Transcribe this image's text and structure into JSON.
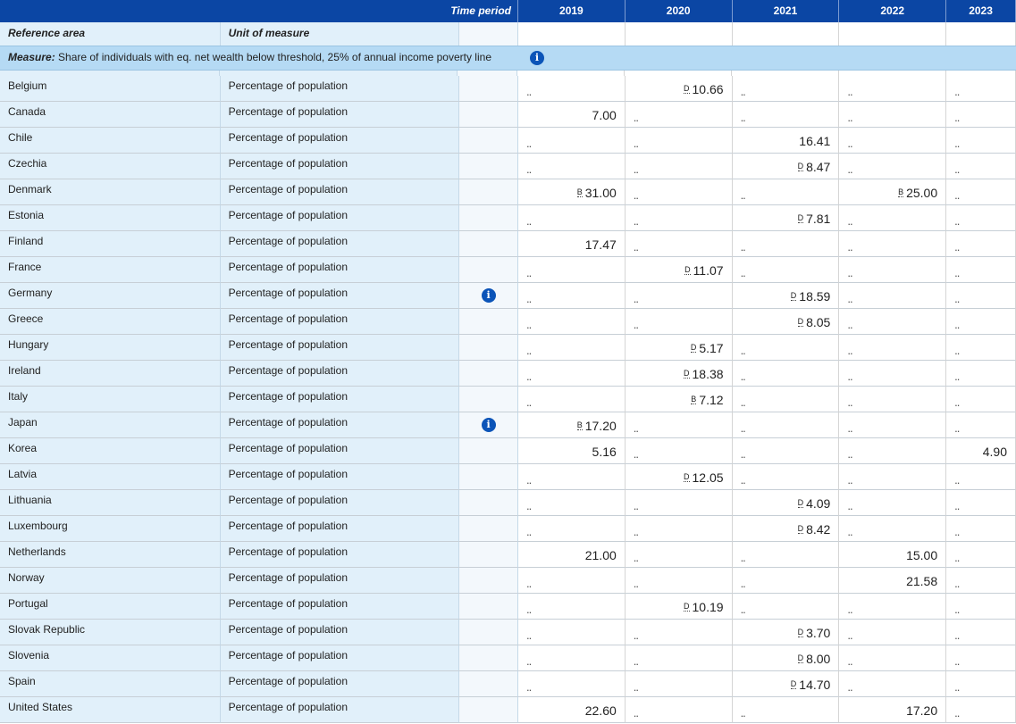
{
  "header": {
    "time_period_label": "Time period",
    "years": [
      "2019",
      "2020",
      "2021",
      "2022",
      "2023"
    ]
  },
  "columns": {
    "reference_area": "Reference area",
    "unit_of_measure": "Unit of measure"
  },
  "measure": {
    "prefix": "Measure:",
    "text": "Share of individuals with eq. net wealth below threshold, 25% of annual income poverty line"
  },
  "missing_symbol": "..",
  "rows": [
    {
      "area": "Belgium",
      "unit": "Percentage of population",
      "info": false,
      "cells": [
        {
          "v": "",
          "f": ""
        },
        {
          "v": "10.66",
          "f": "D"
        },
        {
          "v": "",
          "f": ""
        },
        {
          "v": "",
          "f": ""
        },
        {
          "v": "",
          "f": ""
        }
      ]
    },
    {
      "area": "Canada",
      "unit": "Percentage of population",
      "info": false,
      "cells": [
        {
          "v": "7.00",
          "f": ""
        },
        {
          "v": "",
          "f": ""
        },
        {
          "v": "",
          "f": ""
        },
        {
          "v": "",
          "f": ""
        },
        {
          "v": "",
          "f": ""
        }
      ]
    },
    {
      "area": "Chile",
      "unit": "Percentage of population",
      "info": false,
      "cells": [
        {
          "v": "",
          "f": ""
        },
        {
          "v": "",
          "f": ""
        },
        {
          "v": "16.41",
          "f": ""
        },
        {
          "v": "",
          "f": ""
        },
        {
          "v": "",
          "f": ""
        }
      ]
    },
    {
      "area": "Czechia",
      "unit": "Percentage of population",
      "info": false,
      "cells": [
        {
          "v": "",
          "f": ""
        },
        {
          "v": "",
          "f": ""
        },
        {
          "v": "8.47",
          "f": "D"
        },
        {
          "v": "",
          "f": ""
        },
        {
          "v": "",
          "f": ""
        }
      ]
    },
    {
      "area": "Denmark",
      "unit": "Percentage of population",
      "info": false,
      "cells": [
        {
          "v": "31.00",
          "f": "B"
        },
        {
          "v": "",
          "f": ""
        },
        {
          "v": "",
          "f": ""
        },
        {
          "v": "25.00",
          "f": "B"
        },
        {
          "v": "",
          "f": ""
        }
      ]
    },
    {
      "area": "Estonia",
      "unit": "Percentage of population",
      "info": false,
      "cells": [
        {
          "v": "",
          "f": ""
        },
        {
          "v": "",
          "f": ""
        },
        {
          "v": "7.81",
          "f": "D"
        },
        {
          "v": "",
          "f": ""
        },
        {
          "v": "",
          "f": ""
        }
      ]
    },
    {
      "area": "Finland",
      "unit": "Percentage of population",
      "info": false,
      "cells": [
        {
          "v": "17.47",
          "f": ""
        },
        {
          "v": "",
          "f": ""
        },
        {
          "v": "",
          "f": ""
        },
        {
          "v": "",
          "f": ""
        },
        {
          "v": "",
          "f": ""
        }
      ]
    },
    {
      "area": "France",
      "unit": "Percentage of population",
      "info": false,
      "cells": [
        {
          "v": "",
          "f": ""
        },
        {
          "v": "11.07",
          "f": "D"
        },
        {
          "v": "",
          "f": ""
        },
        {
          "v": "",
          "f": ""
        },
        {
          "v": "",
          "f": ""
        }
      ]
    },
    {
      "area": "Germany",
      "unit": "Percentage of population",
      "info": true,
      "cells": [
        {
          "v": "",
          "f": ""
        },
        {
          "v": "",
          "f": ""
        },
        {
          "v": "18.59",
          "f": "D"
        },
        {
          "v": "",
          "f": ""
        },
        {
          "v": "",
          "f": ""
        }
      ]
    },
    {
      "area": "Greece",
      "unit": "Percentage of population",
      "info": false,
      "cells": [
        {
          "v": "",
          "f": ""
        },
        {
          "v": "",
          "f": ""
        },
        {
          "v": "8.05",
          "f": "D"
        },
        {
          "v": "",
          "f": ""
        },
        {
          "v": "",
          "f": ""
        }
      ]
    },
    {
      "area": "Hungary",
      "unit": "Percentage of population",
      "info": false,
      "cells": [
        {
          "v": "",
          "f": ""
        },
        {
          "v": "5.17",
          "f": "D"
        },
        {
          "v": "",
          "f": ""
        },
        {
          "v": "",
          "f": ""
        },
        {
          "v": "",
          "f": ""
        }
      ]
    },
    {
      "area": "Ireland",
      "unit": "Percentage of population",
      "info": false,
      "cells": [
        {
          "v": "",
          "f": ""
        },
        {
          "v": "18.38",
          "f": "D"
        },
        {
          "v": "",
          "f": ""
        },
        {
          "v": "",
          "f": ""
        },
        {
          "v": "",
          "f": ""
        }
      ]
    },
    {
      "area": "Italy",
      "unit": "Percentage of population",
      "info": false,
      "cells": [
        {
          "v": "",
          "f": ""
        },
        {
          "v": "7.12",
          "f": "B"
        },
        {
          "v": "",
          "f": ""
        },
        {
          "v": "",
          "f": ""
        },
        {
          "v": "",
          "f": ""
        }
      ]
    },
    {
      "area": "Japan",
      "unit": "Percentage of population",
      "info": true,
      "cells": [
        {
          "v": "17.20",
          "f": "B"
        },
        {
          "v": "",
          "f": ""
        },
        {
          "v": "",
          "f": ""
        },
        {
          "v": "",
          "f": ""
        },
        {
          "v": "",
          "f": ""
        }
      ]
    },
    {
      "area": "Korea",
      "unit": "Percentage of population",
      "info": false,
      "cells": [
        {
          "v": "5.16",
          "f": ""
        },
        {
          "v": "",
          "f": ""
        },
        {
          "v": "",
          "f": ""
        },
        {
          "v": "",
          "f": ""
        },
        {
          "v": "4.90",
          "f": ""
        }
      ]
    },
    {
      "area": "Latvia",
      "unit": "Percentage of population",
      "info": false,
      "cells": [
        {
          "v": "",
          "f": ""
        },
        {
          "v": "12.05",
          "f": "D"
        },
        {
          "v": "",
          "f": ""
        },
        {
          "v": "",
          "f": ""
        },
        {
          "v": "",
          "f": ""
        }
      ]
    },
    {
      "area": "Lithuania",
      "unit": "Percentage of population",
      "info": false,
      "cells": [
        {
          "v": "",
          "f": ""
        },
        {
          "v": "",
          "f": ""
        },
        {
          "v": "4.09",
          "f": "D"
        },
        {
          "v": "",
          "f": ""
        },
        {
          "v": "",
          "f": ""
        }
      ]
    },
    {
      "area": "Luxembourg",
      "unit": "Percentage of population",
      "info": false,
      "cells": [
        {
          "v": "",
          "f": ""
        },
        {
          "v": "",
          "f": ""
        },
        {
          "v": "8.42",
          "f": "D"
        },
        {
          "v": "",
          "f": ""
        },
        {
          "v": "",
          "f": ""
        }
      ]
    },
    {
      "area": "Netherlands",
      "unit": "Percentage of population",
      "info": false,
      "cells": [
        {
          "v": "21.00",
          "f": ""
        },
        {
          "v": "",
          "f": ""
        },
        {
          "v": "",
          "f": ""
        },
        {
          "v": "15.00",
          "f": ""
        },
        {
          "v": "",
          "f": ""
        }
      ]
    },
    {
      "area": "Norway",
      "unit": "Percentage of population",
      "info": false,
      "cells": [
        {
          "v": "",
          "f": ""
        },
        {
          "v": "",
          "f": ""
        },
        {
          "v": "",
          "f": ""
        },
        {
          "v": "21.58",
          "f": ""
        },
        {
          "v": "",
          "f": ""
        }
      ]
    },
    {
      "area": "Portugal",
      "unit": "Percentage of population",
      "info": false,
      "cells": [
        {
          "v": "",
          "f": ""
        },
        {
          "v": "10.19",
          "f": "D"
        },
        {
          "v": "",
          "f": ""
        },
        {
          "v": "",
          "f": ""
        },
        {
          "v": "",
          "f": ""
        }
      ]
    },
    {
      "area": "Slovak Republic",
      "unit": "Percentage of population",
      "info": false,
      "cells": [
        {
          "v": "",
          "f": ""
        },
        {
          "v": "",
          "f": ""
        },
        {
          "v": "3.70",
          "f": "D"
        },
        {
          "v": "",
          "f": ""
        },
        {
          "v": "",
          "f": ""
        }
      ]
    },
    {
      "area": "Slovenia",
      "unit": "Percentage of population",
      "info": false,
      "cells": [
        {
          "v": "",
          "f": ""
        },
        {
          "v": "",
          "f": ""
        },
        {
          "v": "8.00",
          "f": "D"
        },
        {
          "v": "",
          "f": ""
        },
        {
          "v": "",
          "f": ""
        }
      ]
    },
    {
      "area": "Spain",
      "unit": "Percentage of population",
      "info": false,
      "cells": [
        {
          "v": "",
          "f": ""
        },
        {
          "v": "",
          "f": ""
        },
        {
          "v": "14.70",
          "f": "D"
        },
        {
          "v": "",
          "f": ""
        },
        {
          "v": "",
          "f": ""
        }
      ]
    },
    {
      "area": "United States",
      "unit": "Percentage of population",
      "info": false,
      "cells": [
        {
          "v": "22.60",
          "f": ""
        },
        {
          "v": "",
          "f": ""
        },
        {
          "v": "",
          "f": ""
        },
        {
          "v": "17.20",
          "f": ""
        },
        {
          "v": "",
          "f": ""
        }
      ]
    }
  ],
  "icons": {
    "info": "info-icon"
  },
  "colors": {
    "header_bg": "#0b46a4",
    "measure_bg": "#b5daf4",
    "label_bg": "#e1f0fa",
    "info_icon": "#0b54b8"
  }
}
